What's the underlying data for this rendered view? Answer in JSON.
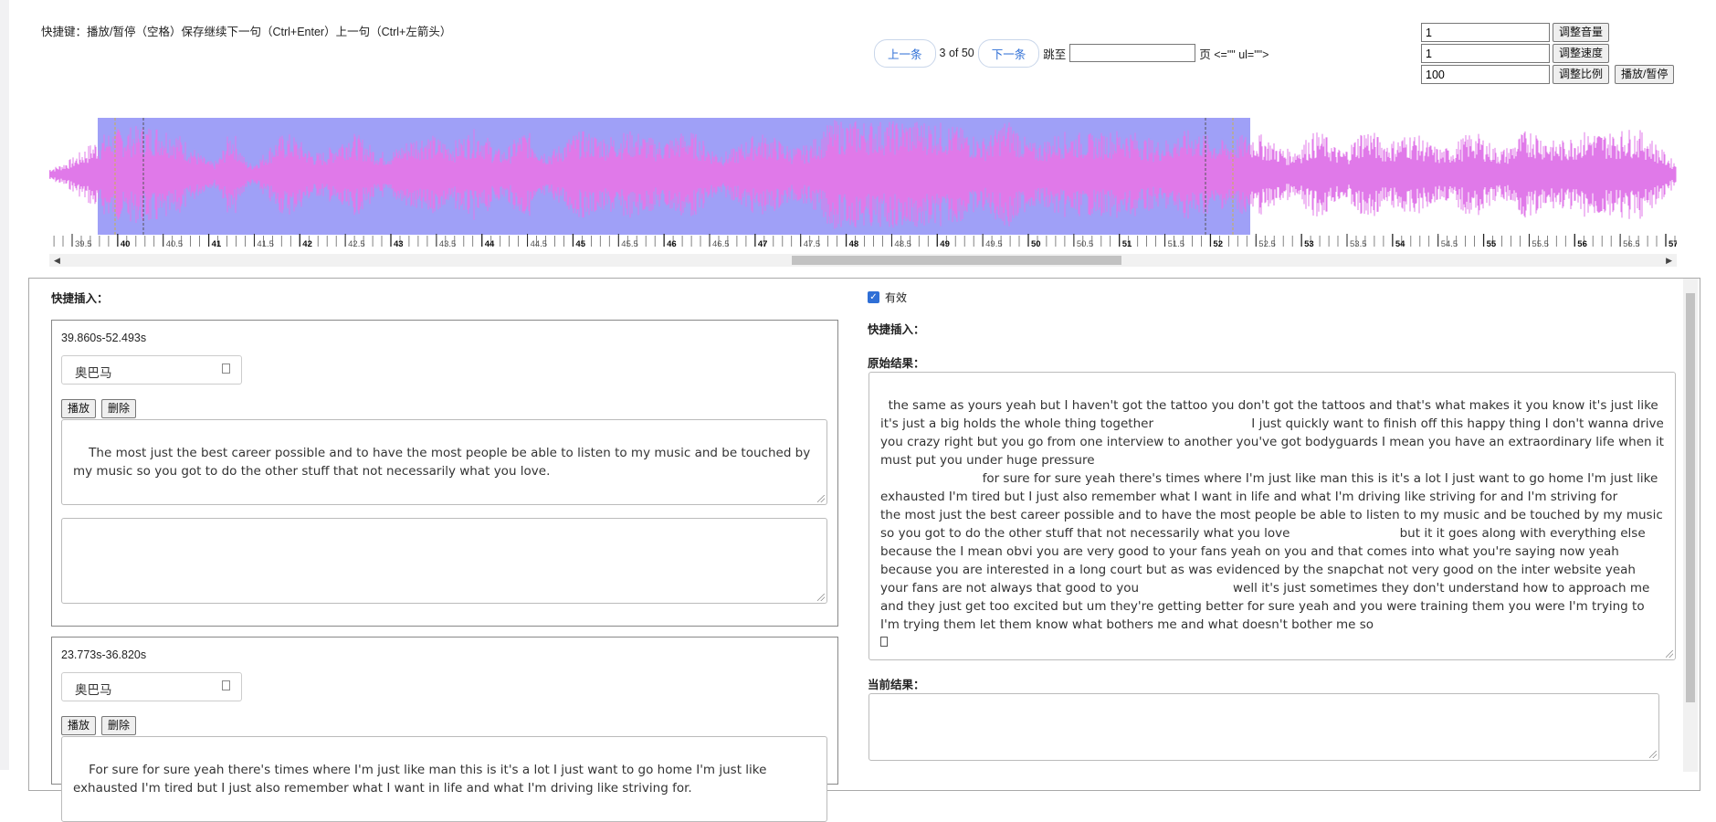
{
  "shortcuts_text": "快捷键：播放/暂停（空格）保存继续下一句（Ctrl+Enter）上一句（Ctrl+左箭头）",
  "nav": {
    "prev_label": "上一条",
    "page_info": "3 of 50",
    "next_label": "下一条",
    "jump_label": "跳至",
    "page_suffix": "页 <=\"\" ul=\"\">"
  },
  "controls": {
    "volume_value": "1",
    "volume_button": "调整音量",
    "speed_value": "1",
    "speed_button": "调整速度",
    "ratio_value": "100",
    "ratio_button": "调整比例",
    "play_pause_button": "播放/暂停"
  },
  "timeline": {
    "ticks": [
      "39.5",
      "40",
      "40.5",
      "41",
      "41.5",
      "42",
      "42.5",
      "43",
      "43.5",
      "44",
      "44.5",
      "45",
      "45.5",
      "46",
      "46.5",
      "47",
      "47.5",
      "48",
      "48.5",
      "49",
      "49.5",
      "50",
      "50.5",
      "51",
      "51.5",
      "52",
      "52.5",
      "53",
      "53.5",
      "54",
      "54.5",
      "55",
      "55.5",
      "56",
      "56.5",
      "57"
    ]
  },
  "colors": {
    "waveform": "#e079e9",
    "selection": "#9fa0f7",
    "accent": "#2f6fd6"
  },
  "left_panel": {
    "quick_insert_label": "快捷插入：",
    "segments": [
      {
        "time": "39.860s-52.493s",
        "speaker": "奥巴马",
        "play_label": "播放",
        "delete_label": "删除",
        "text": "The most just the best career possible and to have the most people be able to listen to my music and be touched by my music so you got to do the other stuff that not necessarily what you love.",
        "note": ""
      },
      {
        "time": "23.773s-36.820s",
        "speaker": "奥巴马",
        "play_label": "播放",
        "delete_label": "删除",
        "text": "For sure for sure yeah there's times where I'm just like man this is it's a lot I just want to go home I'm just like exhausted I'm tired but I just also remember what I want in life and what I'm driving like striving for."
      }
    ]
  },
  "right_panel": {
    "valid_label": "有效",
    "quick_insert_label": "快捷插入：",
    "original_label": "原始结果：",
    "original_text": "the same as yours yeah but I haven't got the tattoo you don't got the tattoos and that's what makes it you know it's just like it's just a big holds the whole thing together                         I just quickly want to finish off this happy thing I don't wanna drive you crazy right but you go from one interview to another you've got bodyguards I mean you have an extraordinary life when it must put you under huge pressure\n                          for sure for sure yeah there's times where I'm just like man this is it's a lot I just want to go home I'm just like exhausted I'm tired but I just also remember what I want in life and what I'm driving like striving for and I'm striving for\nthe most just the best career possible and to have the most people be able to listen to my music and be touched by my music so you got to do the other stuff that not necessarily what you love                            but it it goes along with everything else because the I mean obvi you are very good to your fans yeah on you and that comes into what you're saying now yeah because you are interested in a long court but as was evidenced by the snapchat not very good on the inter website yeah\nyour fans are not always that good to you                        well it's just sometimes they don't understand how to approach me and they just get too excited but um they're getting better for sure yeah and you were training them you were I'm trying to I'm trying them let them know what bothers me and what doesn't bother me so\n",
    "current_label": "当前结果：",
    "current_text": ""
  }
}
